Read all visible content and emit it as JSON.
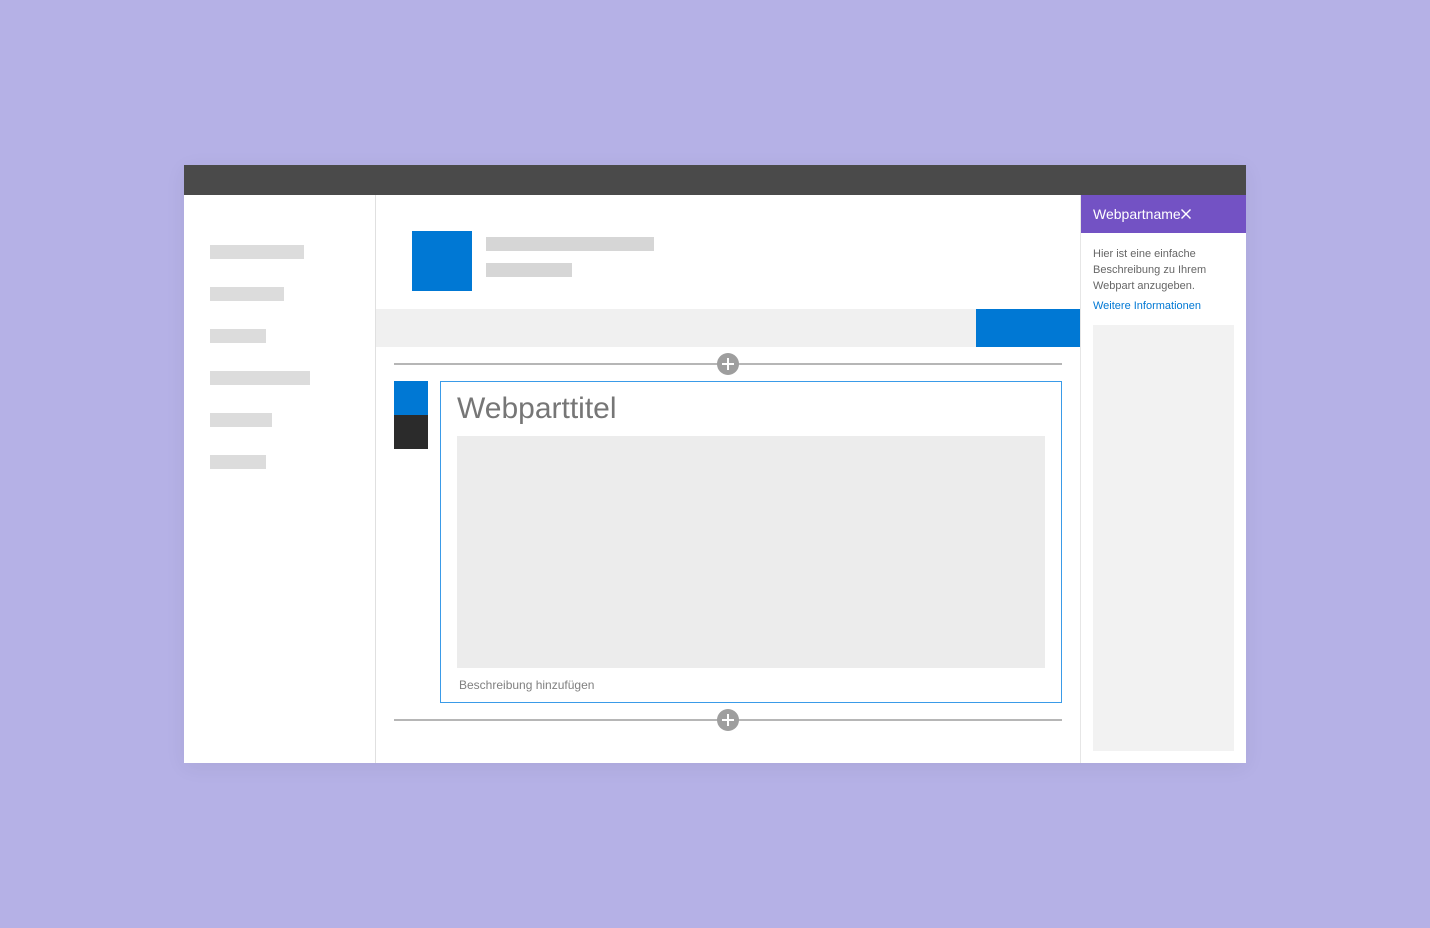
{
  "webpart": {
    "title_placeholder": "Webparttitel",
    "description_placeholder": "Beschreibung hinzufügen"
  },
  "propertyPane": {
    "title": "Webpartname",
    "description": "Hier ist eine einfache Beschreibung zu Ihrem Webpart anzugeben.",
    "learn_more": "Weitere Informationen"
  }
}
